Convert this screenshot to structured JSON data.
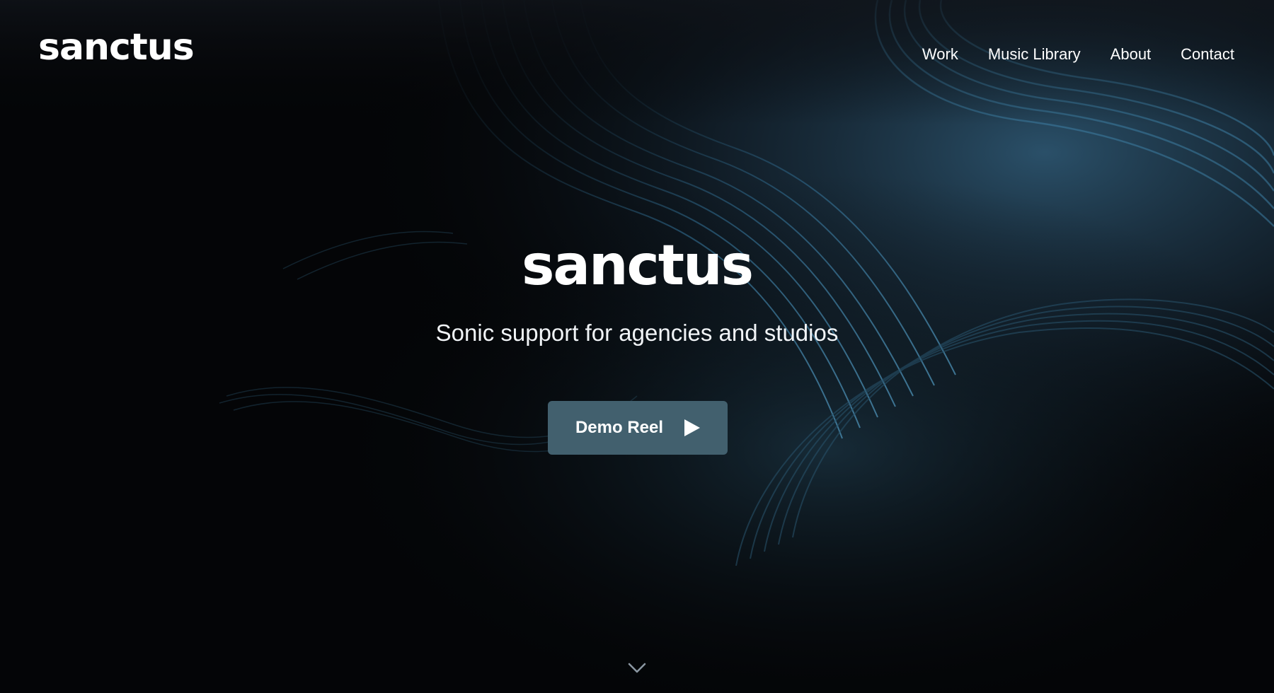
{
  "header": {
    "logo_text": "sanctus",
    "nav": [
      {
        "label": "Work"
      },
      {
        "label": "Music Library"
      },
      {
        "label": "About"
      },
      {
        "label": "Contact"
      }
    ]
  },
  "hero": {
    "logo_text": "sanctus",
    "tagline": "Sonic support for agencies and studios",
    "cta_label": "Demo Reel",
    "cta_icon": "play-icon",
    "scroll_icon": "chevron-down-icon"
  },
  "colors": {
    "background": "#040507",
    "button": "#42606e",
    "text": "#ffffff",
    "accent_wave": "#2f6f93"
  }
}
